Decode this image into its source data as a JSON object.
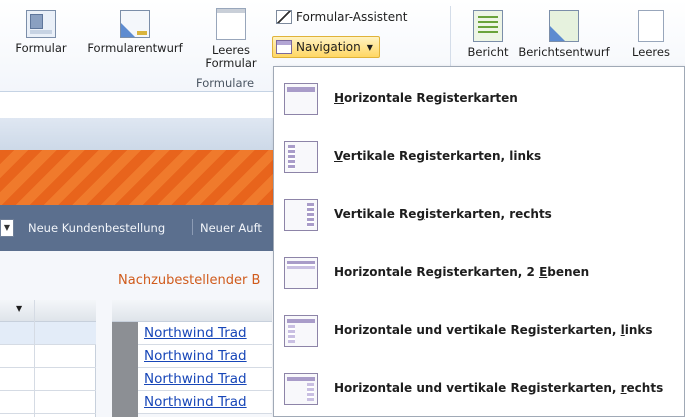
{
  "ribbon": {
    "buttons": [
      {
        "label": "Formular",
        "icon": "form-icon"
      },
      {
        "label": "Formularentwurf",
        "icon": "form-design-icon"
      },
      {
        "label_line1": "Leeres",
        "label_line2": "Formular",
        "icon": "blank-form-icon"
      },
      {
        "label": "Bericht",
        "icon": "report-icon"
      },
      {
        "label": "Berichtsentwurf",
        "icon": "report-design-icon"
      },
      {
        "label": "Leeres",
        "icon": "blank-report-icon"
      }
    ],
    "wizard_label": "Formular-Assistent",
    "navigation_label": "Navigation",
    "group_label": "Formulare"
  },
  "background": {
    "link_bar": [
      "Neue Kundenbestellung",
      "Neuer Auft"
    ],
    "section_title": "Nachzubestellender B",
    "rows": [
      "Northwind Trad",
      "Northwind Trad",
      "Northwind Trad",
      "Northwind Trad"
    ]
  },
  "menu": {
    "items": [
      {
        "pre": "",
        "u": "H",
        "post": "orizontale Registerkarten",
        "icon": "horizontal-tabs-icon"
      },
      {
        "pre": "",
        "u": "V",
        "post": "ertikale Registerkarten, links",
        "icon": "vertical-tabs-left-icon"
      },
      {
        "pre": "Vertikale Re",
        "u": "g",
        "post": "isterkarten, rechts",
        "icon": "vertical-tabs-right-icon"
      },
      {
        "pre": "Horizontale Registerkarten, 2 ",
        "u": "E",
        "post": "benen",
        "icon": "horizontal-tabs-2-levels-icon"
      },
      {
        "pre": "Horizontale und vertikale Registerkarten, ",
        "u": "l",
        "post": "inks",
        "icon": "hv-tabs-left-icon"
      },
      {
        "pre": "Horizontale und vertikale Registerkarten, ",
        "u": "r",
        "post": "echts",
        "icon": "hv-tabs-right-icon"
      }
    ]
  }
}
